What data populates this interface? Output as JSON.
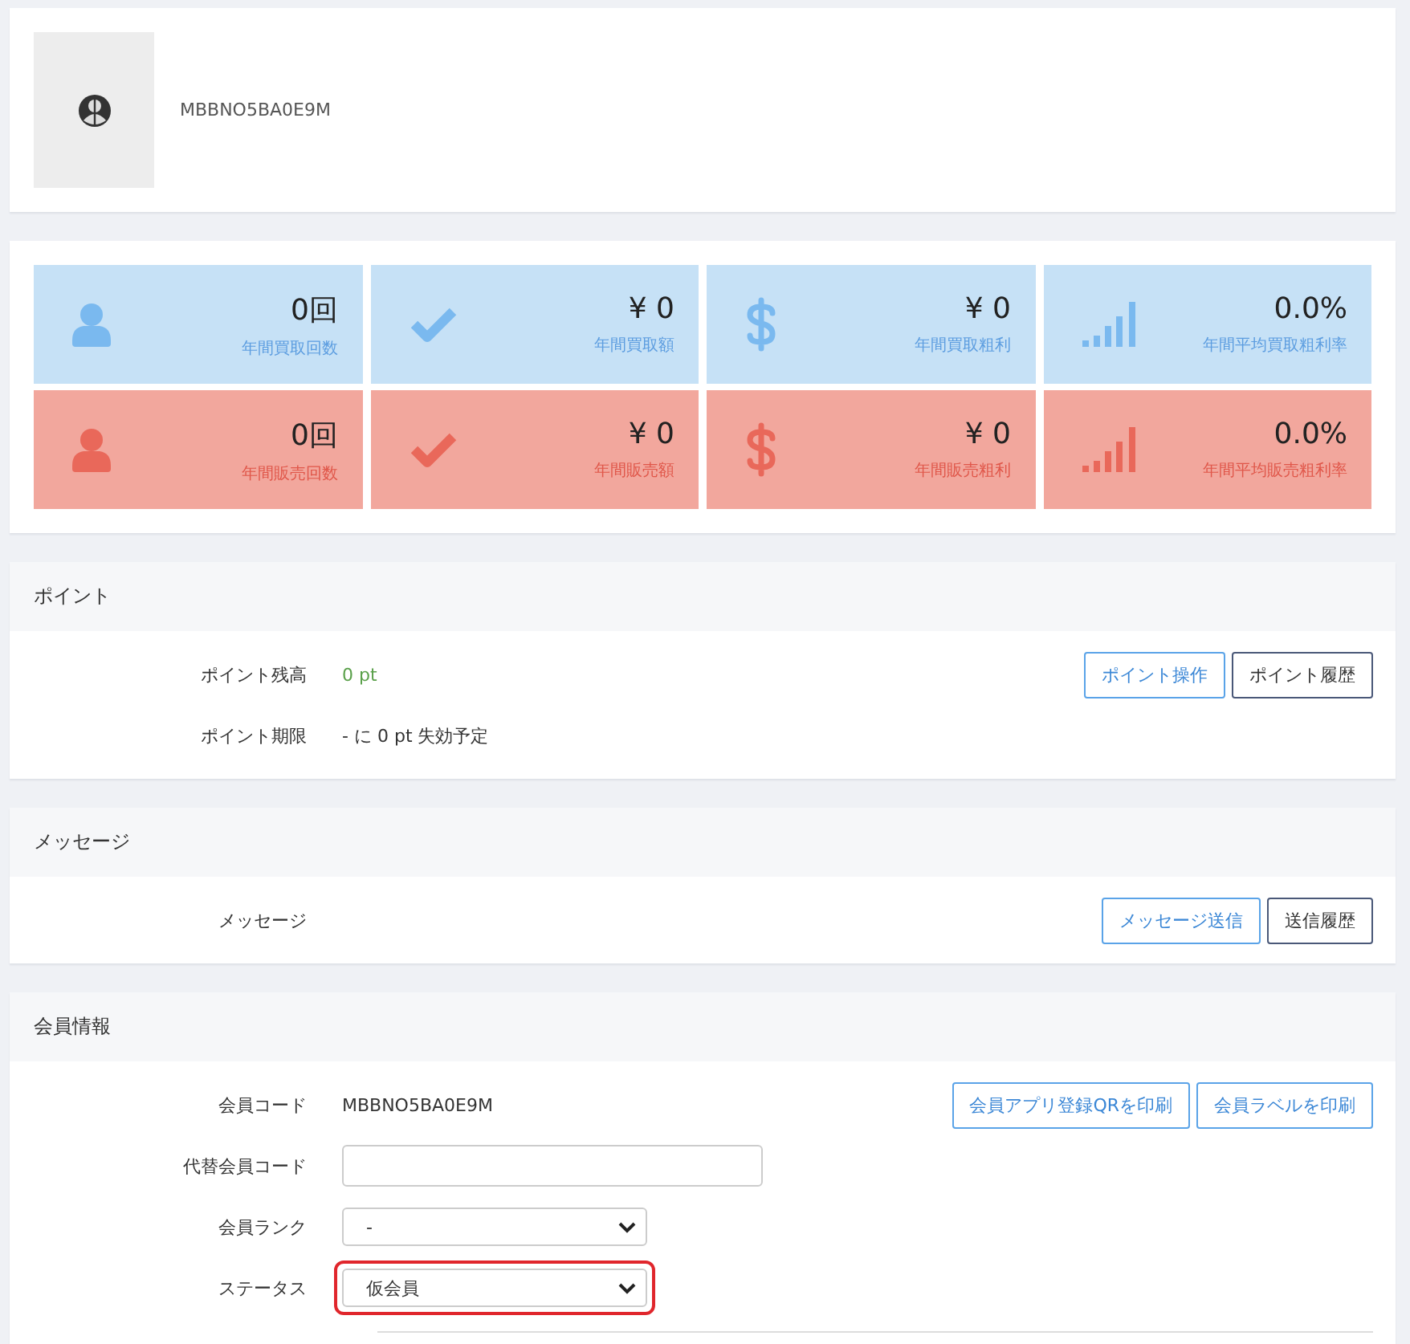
{
  "profile": {
    "code": "MBBNO5BA0E9M"
  },
  "stats": [
    {
      "kind": "buy",
      "value": "0回",
      "label": "年間買取回数"
    },
    {
      "kind": "buy",
      "value": "¥ 0",
      "label": "年間買取額"
    },
    {
      "kind": "buy",
      "value": "¥ 0",
      "label": "年間買取粗利"
    },
    {
      "kind": "buy",
      "value": "0.0%",
      "label": "年間平均買取粗利率"
    },
    {
      "kind": "sell",
      "value": "0回",
      "label": "年間販売回数"
    },
    {
      "kind": "sell",
      "value": "¥ 0",
      "label": "年間販売額"
    },
    {
      "kind": "sell",
      "value": "¥ 0",
      "label": "年間販売粗利"
    },
    {
      "kind": "sell",
      "value": "0.0%",
      "label": "年間平均販売粗利率"
    }
  ],
  "sections": [
    {
      "title": "ポイント",
      "rows": [
        {
          "kind": "text",
          "label": "ポイント残高",
          "value": "0 pt",
          "positive": true,
          "buttons": [
            {
              "label": "ポイント操作",
              "kind": "primary"
            },
            {
              "label": "ポイント履歴",
              "kind": "secondary"
            }
          ]
        },
        {
          "kind": "text",
          "label": "ポイント期限",
          "value": "- に 0 pt 失効予定",
          "positive": false
        }
      ]
    },
    {
      "title": "メッセージ",
      "rows": [
        {
          "kind": "text",
          "label": "メッセージ",
          "buttons": [
            {
              "label": "メッセージ送信",
              "kind": "primary"
            },
            {
              "label": "送信履歴",
              "kind": "secondary"
            }
          ]
        }
      ]
    },
    {
      "title": "会員情報",
      "rows": [
        {
          "kind": "text",
          "label": "会員コード",
          "value": "MBBNO5BA0E9M",
          "positive": false,
          "buttons": [
            {
              "label": "会員アプリ登録QRを印刷",
              "kind": "primary"
            },
            {
              "label": "会員ラベルを印刷",
              "kind": "primary"
            }
          ]
        },
        {
          "kind": "input",
          "label": "代替会員コード"
        },
        {
          "kind": "select",
          "label": "会員ランク",
          "value": "-",
          "highlighted": false
        },
        {
          "kind": "select",
          "label": "ステータス",
          "value": "仮会員",
          "highlighted": true
        }
      ]
    }
  ]
}
